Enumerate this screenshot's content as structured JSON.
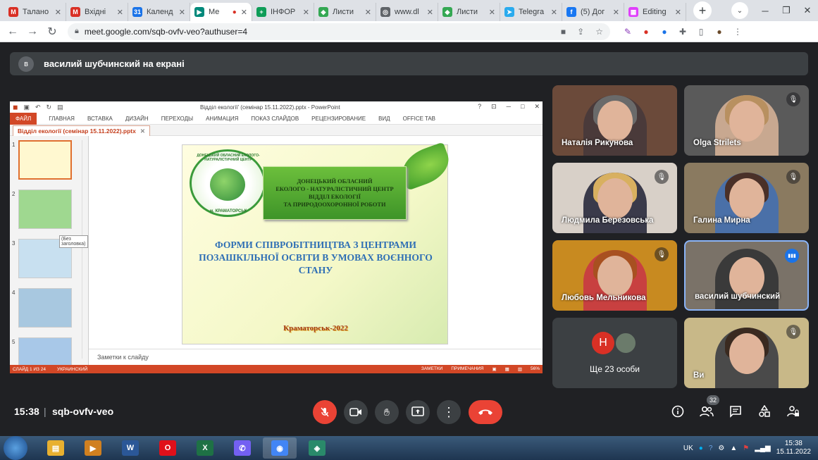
{
  "browser": {
    "tabs": [
      {
        "label": "Талано",
        "color": "#d93025",
        "glyph": "M"
      },
      {
        "label": "Вхідні",
        "color": "#d93025",
        "glyph": "M"
      },
      {
        "label": "Календ",
        "color": "#1a73e8",
        "glyph": "31"
      },
      {
        "label": "Ме",
        "color": "#00897b",
        "glyph": "▶",
        "active": true
      },
      {
        "label": "ІНФОР",
        "color": "#0f9d58",
        "glyph": "+"
      },
      {
        "label": "Листи",
        "color": "#34a853",
        "glyph": "◆"
      },
      {
        "label": "www.dl",
        "color": "#5f6368",
        "glyph": "◎"
      },
      {
        "label": "Листи",
        "color": "#34a853",
        "glyph": "◆"
      },
      {
        "label": "Telegra",
        "color": "#2aabee",
        "glyph": "➤"
      },
      {
        "label": "(5) Дог",
        "color": "#1877f2",
        "glyph": "f"
      },
      {
        "label": "Editing",
        "color": "#e040fb",
        "glyph": "▦"
      }
    ],
    "new_tab": "+",
    "url": "meet.google.com/sqb-ovfv-veo?authuser=4"
  },
  "banner": {
    "avatar_letter": "в",
    "text": "василий шубчинский на екрані"
  },
  "powerpoint": {
    "window_title": "Відділ екології' (семінар 15.11.2022).pptx - PowerPoint",
    "ribbon": [
      "ФАЙЛ",
      "ГЛАВНАЯ",
      "ВСТАВКА",
      "ДИЗАЙН",
      "ПЕРЕХОДЫ",
      "АНИМАЦИЯ",
      "ПОКАЗ СЛАЙДОВ",
      "РЕЦЕНЗИРОВАНИЕ",
      "ВИД",
      "OFFICE TAB"
    ],
    "doc_tab": "Відділ екології (семінар 15.11.2022).pptx",
    "thumbs": [
      "1",
      "2",
      "3",
      "4",
      "5"
    ],
    "tooltip": "(Без заголовка)",
    "slide": {
      "logo_ring": "ДОНЕЦЬКИЙ ОБЛАСНИЙ ЕКОЛОГО-НАТУРАЛІСТИЧНИЙ ЦЕНТР",
      "logo_bottom": "м. КРАМАТОРСЬК",
      "box_lines": [
        "ДОНЕЦЬКИЙ ОБЛАСНИЙ",
        "ЕКОЛОГО - НАТУРАЛІСТИЧНИЙ ЦЕНТР",
        "ВІДДІЛ ЕКОЛОГІЇ",
        "ТА ПРИРОДООХОРОННОЇ РОБОТИ"
      ],
      "title": "ФОРМИ СПІВРОБІТНИЦТВА З ЦЕНТРАМИ ПОЗАШКІЛЬНОЇ ОСВІТИ В УМОВАХ ВОЄННОГО СТАНУ",
      "city": "Краматорськ-2022"
    },
    "notes": "Заметки к слайду",
    "status": {
      "slide": "СЛАЙД 1 ИЗ 24",
      "lang": "УКРАИНСКИЙ",
      "notes": "ЗАМЕТКИ",
      "comments": "ПРИМЕЧАНИЯ",
      "zoom": "56%"
    }
  },
  "participants": [
    {
      "name": "Наталія Рикунова",
      "muted": false,
      "bg": "#6b4a3a",
      "shirt": "#4a3a3a",
      "hair": "#6a6a6a"
    },
    {
      "name": "Olga Strilets",
      "muted": true,
      "bg": "#5a5a5a",
      "shirt": "#c8a890",
      "hair": "#b89060"
    },
    {
      "name": "Людмила Березовська",
      "muted": true,
      "bg": "#d8d0c8",
      "shirt": "#3a3a4a",
      "hair": "#d8b060"
    },
    {
      "name": "Галина Мирна",
      "muted": true,
      "bg": "#8a7a60",
      "shirt": "#4a70a8",
      "hair": "#4a3028"
    },
    {
      "name": "Любовь Мельникова",
      "muted": true,
      "bg": "#c88a20",
      "shirt": "#c84040",
      "hair": "#a85020"
    },
    {
      "name": "василий шубчинский",
      "muted": false,
      "speaking": true,
      "bg": "#7a7268",
      "shirt": "#3a3a3a",
      "hair": "#3a3a3a"
    },
    {
      "name": "Ви",
      "muted": true,
      "bg": "#c8b888",
      "shirt": "#4a4a4a",
      "hair": "#3a2a20"
    }
  ],
  "others": {
    "avatar": "Н",
    "label": "Ще 23 особи"
  },
  "meeting": {
    "time": "15:38",
    "separator": "|",
    "code": "sqb-ovfv-veo",
    "participant_count": "32"
  },
  "taskbar": {
    "apps": [
      {
        "name": "explorer",
        "color": "#e8b030",
        "glyph": "▤"
      },
      {
        "name": "media",
        "color": "#d08020",
        "glyph": "▶"
      },
      {
        "name": "word",
        "color": "#2b5797",
        "glyph": "W"
      },
      {
        "name": "opera",
        "color": "#e0101a",
        "glyph": "O"
      },
      {
        "name": "excel",
        "color": "#1e7145",
        "glyph": "X"
      },
      {
        "name": "viber",
        "color": "#7360f2",
        "glyph": "✆"
      },
      {
        "name": "chrome",
        "color": "#4285f4",
        "glyph": "◉"
      },
      {
        "name": "app",
        "color": "#2a8a6a",
        "glyph": "◈"
      }
    ],
    "lang": "UK",
    "time": "15:38",
    "date": "15.11.2022"
  }
}
